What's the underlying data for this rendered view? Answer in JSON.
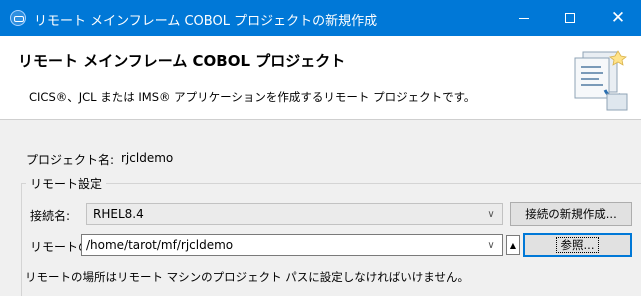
{
  "window": {
    "title": "リモート メインフレーム COBOL プロジェクトの新規作成",
    "minimize_glyph": "—",
    "maximize_glyph": "☐",
    "close_glyph": "✕"
  },
  "banner": {
    "title": "リモート メインフレーム COBOL プロジェクト",
    "description": "CICS®、JCL または IMS® アプリケーションを作成するリモート プロジェクトです。"
  },
  "form": {
    "project_name_label": "プロジェクト名:",
    "project_name_value": "rjcldemo",
    "remote_settings_legend": "リモート設定",
    "connection_label": "接続名:",
    "connection_value": "RHEL8.4",
    "new_connection_button": "接続の新規作成...",
    "location_label": "リモートの場所:",
    "location_value": "/home/tarot/mf/rjcldemo",
    "browse_button": "参照...",
    "hint": "リモートの場所はリモート マシンのプロジェクト パスに設定しなければいけません。"
  },
  "icons": {
    "app": "eclipse-app-icon",
    "banner": "remote-project-wizard-icon",
    "dropdown": "chevron-down-icon"
  },
  "colors": {
    "titlebar": "#0078d7",
    "banner_bg": "#ffffff",
    "dialog_bg": "#f0f0f0"
  }
}
